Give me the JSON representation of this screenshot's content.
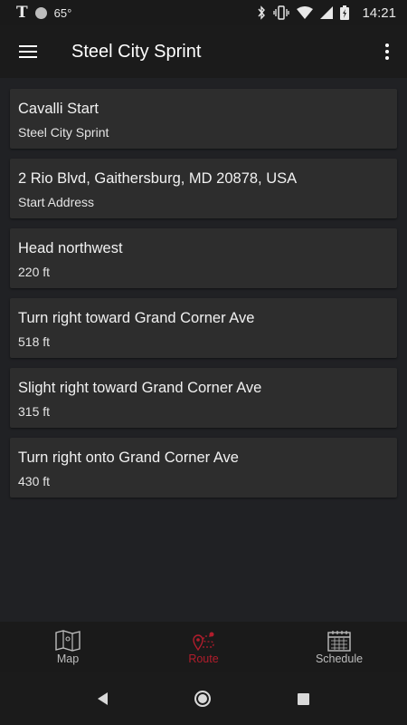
{
  "status_bar": {
    "carrier_icon": "T",
    "temperature": "65°",
    "time": "14:21"
  },
  "app_bar": {
    "title": "Steel City Sprint"
  },
  "route_steps": [
    {
      "primary": "Cavalli Start",
      "secondary": "Steel City Sprint"
    },
    {
      "primary": "2 Rio Blvd, Gaithersburg, MD 20878, USA",
      "secondary": "Start Address"
    },
    {
      "primary": "Head northwest",
      "secondary": "220 ft"
    },
    {
      "primary": "Turn right toward Grand Corner Ave",
      "secondary": "518 ft"
    },
    {
      "primary": "Slight right toward Grand Corner Ave",
      "secondary": "315 ft"
    },
    {
      "primary": "Turn right onto Grand Corner Ave",
      "secondary": "430 ft"
    }
  ],
  "bottom_nav": {
    "items": [
      {
        "label": "Map",
        "icon": "map-icon",
        "active": false
      },
      {
        "label": "Route",
        "icon": "route-icon",
        "active": true
      },
      {
        "label": "Schedule",
        "icon": "calendar-icon",
        "active": false
      }
    ]
  },
  "colors": {
    "background": "#202124",
    "card": "#2d2d2d",
    "accent": "#b11d2c"
  }
}
